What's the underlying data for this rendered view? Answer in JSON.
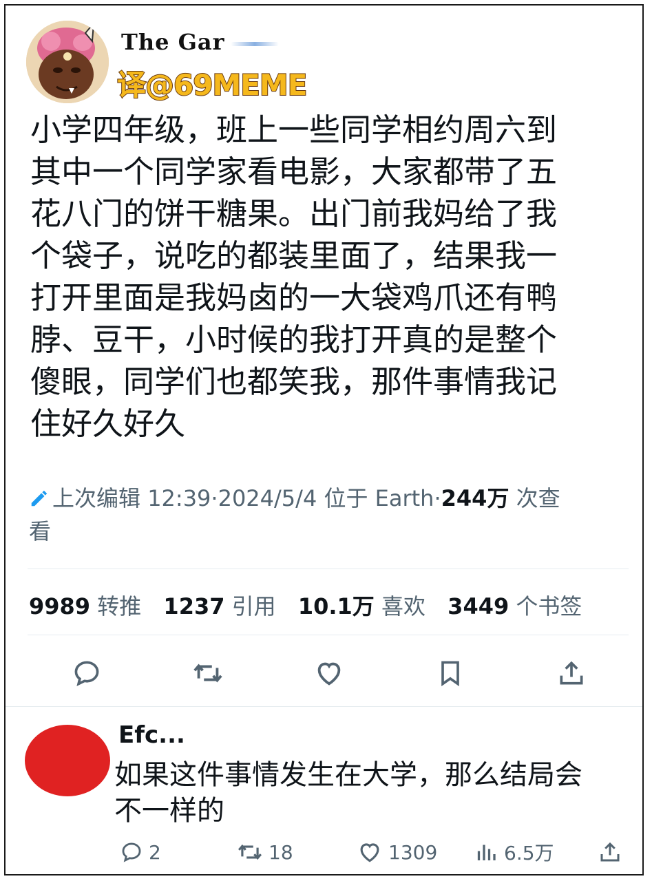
{
  "author": {
    "name": "The Gar",
    "translator_credit": "译@69MEME"
  },
  "tweet": {
    "text": "小学四年级，班上一些同学相约周六到\n其中一个同学家看电影，大家都带了五\n花八门的饼干糖果。出门前我妈给了我\n个袋子，说吃的都装里面了，结果我一\n打开里面是我妈卤的一大袋鸡爪还有鸭\n脖、豆干，小时候的我打开真的是整个\n傻眼，同学们也都笑我，那件事情我记\n住好久好久",
    "edited_prefix": "上次编辑",
    "time": "12:39",
    "sep": "·",
    "date": "2024/5/4",
    "location": "位于 Earth",
    "views_count": "244万",
    "views_label_1": "次查",
    "views_label_2": "看"
  },
  "stats": {
    "retweets": "9989",
    "retweets_label": "转推",
    "quotes": "1237",
    "quotes_label": "引用",
    "likes": "10.1万",
    "likes_label": "喜欢",
    "bookmarks": "3449",
    "bookmarks_label": "个书签"
  },
  "actions": [
    "reply-icon",
    "retweet-icon",
    "like-icon",
    "bookmark-icon",
    "share-icon"
  ],
  "reply": {
    "name": "Efc...",
    "text_line1": "如果这件事情发生在大学，那么结局会",
    "text_line2": "不一样的",
    "replies": "2",
    "retweets": "18",
    "likes": "1309",
    "views": "6.5万"
  },
  "colors": {
    "text": "#0f1419",
    "muted": "#536471",
    "accent": "#1d9bf0",
    "reply_avatar": "#e02222",
    "translator": "#f5b81c"
  }
}
